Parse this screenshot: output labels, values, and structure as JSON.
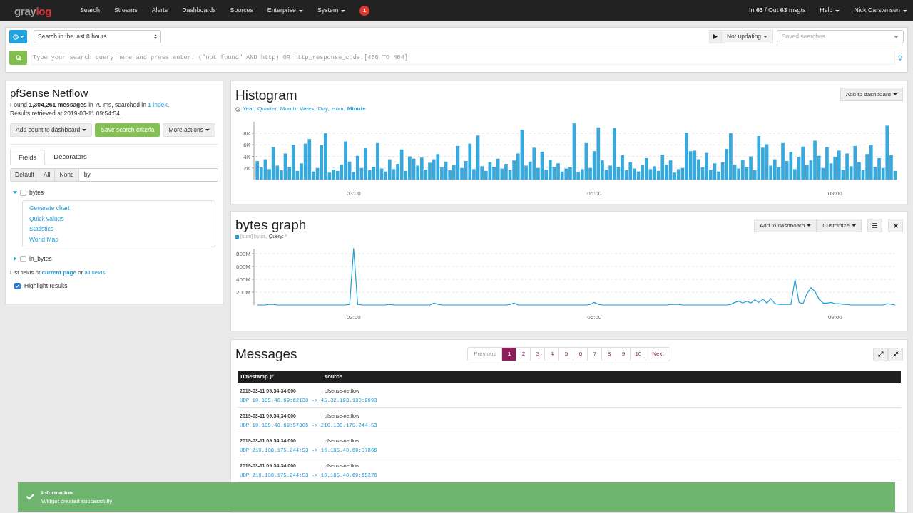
{
  "navbar": {
    "logo": [
      "gray",
      "log"
    ],
    "items": [
      {
        "label": "Search",
        "dropdown": false
      },
      {
        "label": "Streams",
        "dropdown": false
      },
      {
        "label": "Alerts",
        "dropdown": false
      },
      {
        "label": "Dashboards",
        "dropdown": false
      },
      {
        "label": "Sources",
        "dropdown": false
      },
      {
        "label": "Enterprise",
        "dropdown": true
      },
      {
        "label": "System",
        "dropdown": true
      }
    ],
    "badge": "1",
    "throughput": "In **63** / Out **63** msg/s",
    "right_items": [
      {
        "label": "Help",
        "dropdown": true
      },
      {
        "label": "Nick Carstensen",
        "dropdown": true
      }
    ]
  },
  "search_bar": {
    "time_range": "Search in the last 8 hours",
    "refresh": "Not updating",
    "saved_searches": {
      "placeholder": "Saved searches"
    },
    "query": {
      "placeholder": "Type your search query here and press enter. (\"not found\" AND http) OR http_response_code:[400 TO 404]"
    }
  },
  "summary": {
    "title": "pfSense Netflow",
    "found": "Found **1,304,261 messages** in 79 ms, searched in ",
    "index_link": "1 index",
    "found_end": ".",
    "retrieved": "Results retrieved at 2019-03-11 09:54:54.",
    "buttons": [
      {
        "label": "Add count to dashboard",
        "kind": "dropdown"
      },
      {
        "label": "Save search criteria",
        "kind": "primary"
      },
      {
        "label": "More actions",
        "kind": "dropdown"
      }
    ]
  },
  "fields": {
    "tabs": [
      {
        "label": "Fields",
        "selected": true
      },
      {
        "label": "Decorators",
        "selected": false
      }
    ],
    "filter_buttons": [
      "Default",
      "All",
      "None"
    ],
    "filter": {
      "value": "by"
    },
    "items": [
      {
        "name": "bytes",
        "expanded": true,
        "checked": false,
        "actions": [
          "Generate chart",
          "Quick values",
          "Statistics",
          "World Map"
        ]
      },
      {
        "name": "in_bytes",
        "expanded": false,
        "checked": false
      }
    ],
    "list_fields": {
      "before": "List fields of ",
      "links": [
        {
          "label": "current page",
          "selected": true
        },
        {
          "label": "all fields",
          "selected": false
        }
      ],
      "between": " or ",
      "after": "."
    },
    "highlight": {
      "label": "Highlight results",
      "checked": true
    }
  },
  "histogram": {
    "title": "Histogram",
    "resolutions": [
      {
        "label": "Year,",
        "selected": false
      },
      {
        "label": "Quarter,",
        "selected": false
      },
      {
        "label": "Month,",
        "selected": false
      },
      {
        "label": "Week,",
        "selected": false
      },
      {
        "label": "Day,",
        "selected": false
      },
      {
        "label": "Hour,",
        "selected": false
      },
      {
        "label": "Minute",
        "selected": true
      }
    ],
    "button": {
      "label": "Add to dashboard",
      "kind": "dropdown"
    },
    "chart_data": {
      "type": "bar",
      "grid": true,
      "categories": [
        null,
        null,
        null,
        null,
        null,
        null,
        null,
        null,
        null,
        null,
        null,
        null,
        null,
        null,
        null,
        null,
        null,
        null,
        null,
        null,
        null,
        null,
        null,
        null,
        "03:00",
        null,
        null,
        null,
        null,
        null,
        null,
        null,
        null,
        null,
        null,
        null,
        null,
        null,
        null,
        null,
        null,
        null,
        null,
        null,
        null,
        null,
        null,
        null,
        null,
        null,
        null,
        null,
        null,
        null,
        null,
        null,
        null,
        null,
        null,
        null,
        null,
        null,
        null,
        null,
        null,
        null,
        null,
        null,
        null,
        null,
        null,
        null,
        null,
        null,
        null,
        null,
        null,
        null,
        null,
        null,
        null,
        null,
        null,
        null,
        "06:00",
        null,
        null,
        null,
        null,
        null,
        null,
        null,
        null,
        null,
        null,
        null,
        null,
        null,
        null,
        null,
        null,
        null,
        null,
        null,
        null,
        null,
        null,
        null,
        null,
        null,
        null,
        null,
        null,
        null,
        null,
        null,
        null,
        null,
        null,
        null,
        null,
        null,
        null,
        null,
        null,
        null,
        null,
        null,
        null,
        null,
        null,
        null,
        null,
        null,
        null,
        null,
        null,
        null,
        null,
        null,
        null,
        null,
        null,
        null,
        "09:00",
        null,
        null,
        null,
        null,
        null,
        null,
        null,
        null,
        null,
        null,
        null,
        null,
        null,
        null,
        null
      ],
      "ylim": [
        0,
        10
      ],
      "yticks": [
        {
          "value": 2,
          "label": "2K"
        },
        {
          "value": 4,
          "label": "4K"
        },
        {
          "value": 6,
          "label": "6K"
        },
        {
          "value": 8,
          "label": "8K"
        }
      ],
      "series": [
        {
          "color": "#38a9dd",
          "values": [
            3.2,
            2.1,
            3.5,
            1.8,
            5.6,
            2.4,
            1.6,
            4.5,
            2.2,
            6.0,
            1.5,
            2.8,
            6.2,
            7.0,
            1.4,
            2.0,
            5.9,
            8.0,
            1.2,
            1.7,
            1.5,
            2.6,
            6.6,
            3.1,
            1.3,
            4.1,
            2.0,
            5.4,
            1.6,
            2.2,
            6.3,
            1.9,
            1.4,
            3.5,
            1.8,
            2.7,
            5.2,
            1.5,
            4.0,
            3.6,
            2.4,
            3.8,
            1.7,
            2.9,
            3.5,
            4.4,
            2.1,
            3.1,
            1.6,
            2.5,
            5.8,
            2.0,
            3.2,
            6.2,
            1.8,
            7.6,
            2.3,
            1.5,
            3.0,
            2.2,
            3.6,
            1.9,
            2.7,
            1.6,
            3.3,
            4.5,
            8.6,
            2.4,
            3.1,
            5.5,
            2.0,
            4.8,
            1.7,
            3.4,
            2.2,
            2.8,
            1.4,
            1.9,
            2.1,
            9.7,
            1.3,
            1.8,
            6.3,
            2.0,
            4.9,
            9.0,
            3.3,
            1.7,
            2.4,
            8.9,
            2.2,
            4.2,
            1.6,
            3.0,
            1.9,
            1.4,
            2.5,
            3.7,
            1.8,
            2.3,
            1.5,
            4.3,
            2.6,
            3.3,
            1.2,
            1.8,
            2.0,
            8.1,
            4.9,
            5.0,
            3.5,
            2.1,
            4.6,
            1.7,
            2.8,
            1.4,
            3.0,
            5.3,
            8.0,
            2.6,
            1.9,
            3.4,
            2.2,
            4.0,
            1.6,
            7.5,
            5.5,
            6.1,
            2.4,
            3.5,
            2.1,
            6.3,
            3.2,
            4.8,
            1.8,
            3.9,
            5.7,
            2.5,
            3.3,
            6.7,
            4.1,
            2.0,
            5.6,
            2.8,
            3.9,
            5.0,
            1.7,
            4.5,
            2.3,
            5.8,
            3.0,
            1.6,
            4.4,
            6.0,
            2.2,
            3.7,
            2.0,
            9.3,
            4.2,
            1.5
          ]
        }
      ]
    }
  },
  "bytes_graph": {
    "title": "bytes graph",
    "legend": {
      "series": "[sum] bytes,",
      "query_label": "Query:",
      "query": "*"
    },
    "buttons": [
      {
        "label": "Add to dashboard",
        "kind": "dropdown"
      },
      {
        "label": "Customize",
        "kind": "dropdown"
      },
      {
        "kind": "menu"
      },
      {
        "kind": "close"
      }
    ],
    "chart_data": {
      "type": "line",
      "grid": true,
      "categories": [
        null,
        null,
        null,
        null,
        null,
        null,
        null,
        null,
        null,
        null,
        null,
        null,
        null,
        null,
        null,
        null,
        null,
        null,
        null,
        null,
        null,
        null,
        null,
        null,
        "03:00",
        null,
        null,
        null,
        null,
        null,
        null,
        null,
        null,
        null,
        null,
        null,
        null,
        null,
        null,
        null,
        null,
        null,
        null,
        null,
        null,
        null,
        null,
        null,
        null,
        null,
        null,
        null,
        null,
        null,
        null,
        null,
        null,
        null,
        null,
        null,
        null,
        null,
        null,
        null,
        null,
        null,
        null,
        null,
        null,
        null,
        null,
        null,
        null,
        null,
        null,
        null,
        null,
        null,
        null,
        null,
        null,
        null,
        null,
        null,
        "06:00",
        null,
        null,
        null,
        null,
        null,
        null,
        null,
        null,
        null,
        null,
        null,
        null,
        null,
        null,
        null,
        null,
        null,
        null,
        null,
        null,
        null,
        null,
        null,
        null,
        null,
        null,
        null,
        null,
        null,
        null,
        null,
        null,
        null,
        null,
        null,
        null,
        null,
        null,
        null,
        null,
        null,
        null,
        null,
        null,
        null,
        null,
        null,
        null,
        null,
        null,
        null,
        null,
        null,
        null,
        null,
        null,
        null,
        null,
        null,
        "09:00",
        null,
        null,
        null,
        null,
        null,
        null,
        null,
        null,
        null,
        null,
        null,
        null,
        null,
        null,
        null
      ],
      "ylim": [
        0,
        900
      ],
      "yticks": [
        {
          "value": 200,
          "label": "200M"
        },
        {
          "value": 400,
          "label": "400M"
        },
        {
          "value": 600,
          "label": "600M"
        },
        {
          "value": 800,
          "label": "800M"
        }
      ],
      "series": [
        {
          "color": "#1f9fd7",
          "values": [
            0,
            0,
            0,
            10,
            10,
            0,
            0,
            0,
            0,
            0,
            0,
            0,
            0,
            0,
            0,
            0,
            0,
            0,
            0,
            0,
            0,
            0,
            0,
            10,
            880,
            10,
            0,
            0,
            0,
            0,
            0,
            0,
            0,
            10,
            0,
            0,
            0,
            0,
            0,
            0,
            0,
            0,
            0,
            0,
            30,
            10,
            0,
            0,
            0,
            0,
            0,
            0,
            0,
            0,
            0,
            0,
            0,
            0,
            0,
            0,
            0,
            0,
            0,
            10,
            30,
            0,
            0,
            0,
            0,
            0,
            0,
            0,
            0,
            0,
            0,
            0,
            0,
            0,
            0,
            0,
            0,
            0,
            0,
            10,
            40,
            10,
            0,
            0,
            0,
            0,
            0,
            0,
            0,
            0,
            0,
            0,
            0,
            0,
            0,
            0,
            0,
            0,
            0,
            10,
            10,
            10,
            0,
            0,
            0,
            0,
            0,
            0,
            0,
            0,
            0,
            0,
            0,
            0,
            10,
            40,
            60,
            30,
            60,
            30,
            80,
            40,
            90,
            30,
            100,
            20,
            10,
            10,
            10,
            10,
            400,
            40,
            20,
            180,
            270,
            210,
            90,
            30,
            30,
            40,
            20,
            20,
            10,
            10,
            0,
            0,
            0,
            0,
            0,
            0,
            0,
            0,
            0,
            20,
            10,
            0
          ]
        }
      ]
    }
  },
  "messages": {
    "title": "Messages",
    "pagination": {
      "previous": {
        "label": "Previous",
        "disabled": true
      },
      "pages": [
        {
          "label": "1",
          "selected": true
        },
        {
          "label": "2",
          "selected": false
        },
        {
          "label": "3",
          "selected": false
        },
        {
          "label": "4",
          "selected": false
        },
        {
          "label": "5",
          "selected": false
        },
        {
          "label": "6",
          "selected": false
        },
        {
          "label": "7",
          "selected": false
        },
        {
          "label": "8",
          "selected": false
        },
        {
          "label": "9",
          "selected": false
        },
        {
          "label": "10",
          "selected": false
        }
      ],
      "next": {
        "label": "Next",
        "disabled": false
      }
    },
    "controls": [
      {
        "kind": "expand"
      },
      {
        "kind": "collapse"
      }
    ],
    "columns": [
      {
        "label": "Timestamp",
        "sorted": true
      },
      {
        "label": "source",
        "sorted": false
      }
    ],
    "rows": [
      {
        "timestamp": "2019-03-11 09:54:34.000",
        "source": "pfsense-netflow",
        "message": "UDP 10.185.40.69:62138 -> 45.32.198.130:9993"
      },
      {
        "timestamp": "2019-03-11 09:54:34.000",
        "source": "pfsense-netflow",
        "message": "UDP 10.185.40.69:57806 -> 210.138.175.244:53"
      },
      {
        "timestamp": "2019-03-11 09:54:34.000",
        "source": "pfsense-netflow",
        "message": "UDP 210.138.175.244:53 -> 10.185.40.69:57806"
      },
      {
        "timestamp": "2019-03-11 09:54:34.000",
        "source": "pfsense-netflow",
        "message": "UDP 210.138.175.244:53 -> 10.185.40.69:65276"
      }
    ]
  },
  "toast": {
    "title": "Information",
    "text": "Widget created successfully"
  }
}
